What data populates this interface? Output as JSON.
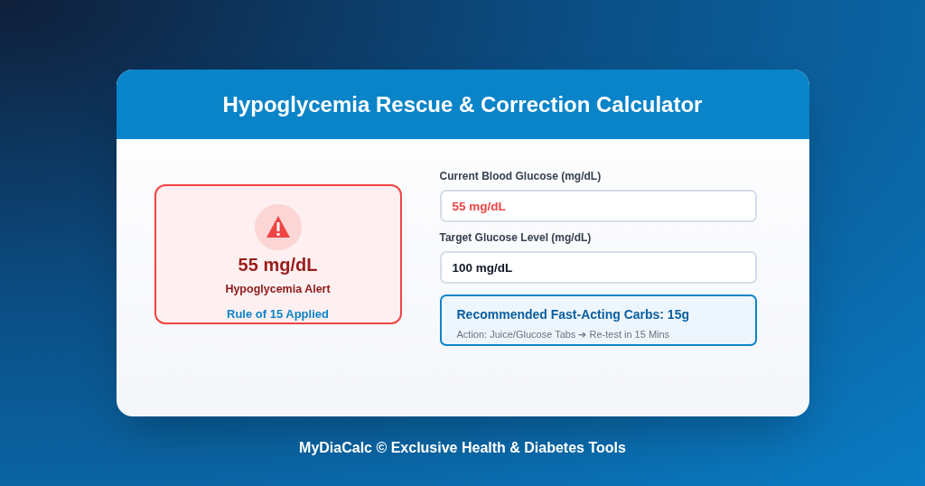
{
  "header": {
    "title": "Hypoglycemia Rescue & Correction Calculator"
  },
  "alert": {
    "reading": "55 mg/dL",
    "status": "Hypoglycemia Alert",
    "rule": "Rule of 15 Applied"
  },
  "fields": [
    {
      "label": "Current Blood Glucose (mg/dL)",
      "value": "55 mg/dL",
      "alert": true
    },
    {
      "label": "Target Glucose Level (mg/dL)",
      "value": "100 mg/dL",
      "alert": false
    }
  ],
  "recommendation": {
    "title": "Recommended Fast-Acting Carbs: 15g",
    "action": "Action: Juice/Glucose Tabs ➔ Re-test in 15 Mins"
  },
  "footer": "MyDiaCalc © Exclusive Health & Diabetes Tools"
}
